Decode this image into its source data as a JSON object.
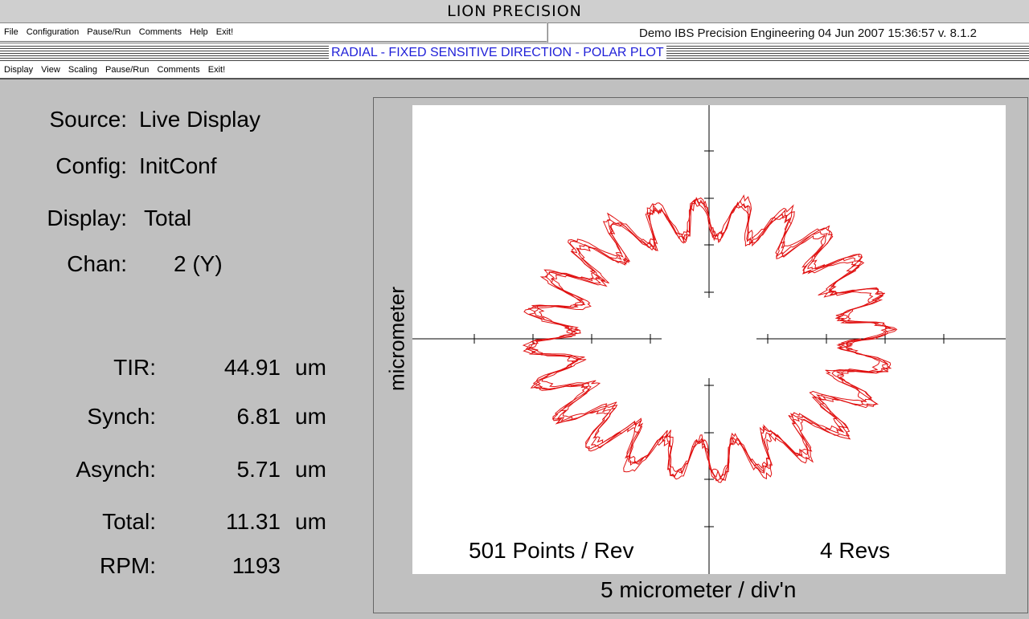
{
  "app_title": "LION PRECISION",
  "menu1": [
    "File",
    "Configuration",
    "Pause/Run",
    "Comments",
    "Help",
    "Exit!"
  ],
  "status": "Demo  IBS Precision Engineering   04 Jun 2007   15:36:57   v. 8.1.2",
  "banner": "RADIAL - FIXED SENSITIVE DIRECTION - POLAR PLOT",
  "menu2": [
    "Display",
    "View",
    "Scaling",
    "Pause/Run",
    "Comments",
    "Exit!"
  ],
  "info": {
    "source_label": "Source:",
    "source_value": "Live Display",
    "config_label": "Config:",
    "config_value": "InitConf",
    "display_label": "Display:",
    "display_value": "Total",
    "chan_label": "Chan:",
    "chan_value": "2 (Y)"
  },
  "metrics": [
    {
      "label": "TIR:",
      "value": "44.91",
      "unit": "um"
    },
    {
      "label": "Synch:",
      "value": "6.81",
      "unit": "um"
    },
    {
      "label": "Asynch:",
      "value": "5.71",
      "unit": "um"
    },
    {
      "label": "Total:",
      "value": "11.31",
      "unit": "um"
    },
    {
      "label": "RPM:",
      "value": "1193",
      "unit": ""
    }
  ],
  "plot": {
    "ylabel": "micrometer",
    "xlabel": "5 micrometer / div'n",
    "points_text": "501 Points / Rev",
    "revs_text": "4 Revs",
    "trace_color": "#e01010"
  },
  "chart_data": {
    "type": "polar",
    "scale_um_per_div": 5,
    "points_per_rev": 501,
    "revs": 4,
    "lobes": 24,
    "mean_radius_div": 2.63,
    "lobe_amplitude_div": 0.38
  }
}
